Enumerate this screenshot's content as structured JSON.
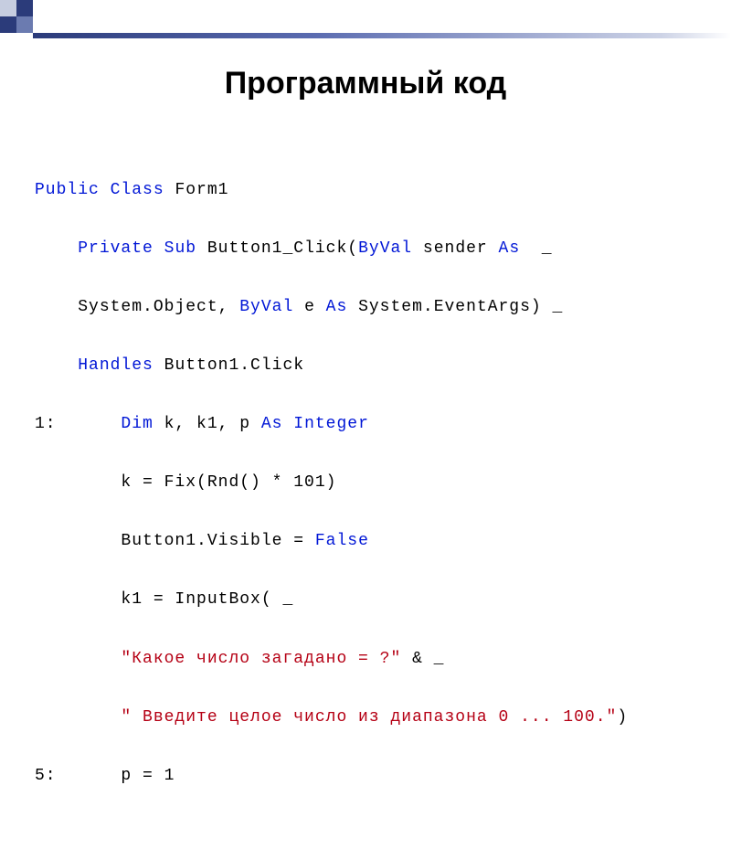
{
  "title": "Программный код",
  "code": {
    "l1_kw1": "Public",
    "l1_kw2": "Class",
    "l1_t1": " Form1",
    "l2_kw1": "Private",
    "l2_kw2": "Sub",
    "l2_t1": " Button1_Click(",
    "l2_kw3": "ByVal",
    "l2_t2": " sender ",
    "l2_kw4": "As",
    "l2_t3": "  _",
    "l3_t1": "System.Object, ",
    "l3_kw1": "ByVal",
    "l3_t2": " e ",
    "l3_kw2": "As",
    "l3_t3": " System.EventArgs) _",
    "l4_kw1": "Handles",
    "l4_t1": " Button1.Click",
    "l5_num": "1:",
    "l5_kw1": "Dim",
    "l5_t1": " k, k1, p ",
    "l5_kw2": "As",
    "l5_kw3": "Integer",
    "l6_t1": "k = Fix(Rnd() * 101)",
    "l7_t1": "Button1.Visible = ",
    "l7_kw1": "False",
    "l8_t1": "k1 = InputBox( _",
    "l9_s1": "\"Какое число загадано = ?\"",
    "l9_t1": " & _",
    "l10_s1": "\" Введите целое число из диапазона 0 ... 100.\"",
    "l10_t1": ")",
    "l11_num": "5:",
    "l11_t1": "p = 1"
  }
}
